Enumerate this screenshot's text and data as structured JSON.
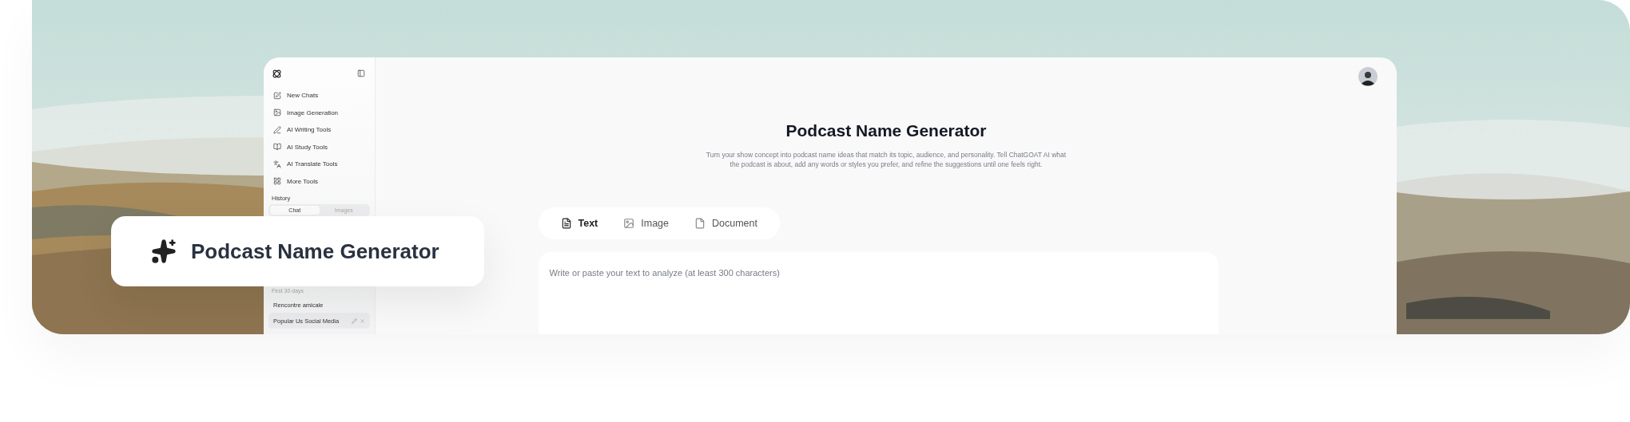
{
  "sidebar": {
    "items": [
      {
        "label": "New Chats"
      },
      {
        "label": "Image Generation"
      },
      {
        "label": "AI Writing Tools"
      },
      {
        "label": "AI Study Tools"
      },
      {
        "label": "AI Translate Tools"
      },
      {
        "label": "More Tools"
      }
    ],
    "history": {
      "title": "History",
      "tabs": [
        {
          "label": "Chat",
          "selected": true
        },
        {
          "label": "Images",
          "selected": false
        }
      ],
      "section": "First 30 days",
      "entries": [
        {
          "label": "Rencontre amicale",
          "selected": false
        },
        {
          "label": "Popular Us Social Media",
          "selected": true
        }
      ]
    }
  },
  "main": {
    "title": "Podcast Name Generator",
    "description": "Turn your show concept into podcast name ideas that match its topic, audience, and personality. Tell ChatGOAT AI what the podcast is about, add any words or styles you prefer, and refine the suggestions until one feels right.",
    "tabs": [
      {
        "label": "Text",
        "selected": true
      },
      {
        "label": "Image",
        "selected": false
      },
      {
        "label": "Document",
        "selected": false
      }
    ],
    "input": {
      "placeholder": "Write or paste your text to analyze (at least 300 characters)"
    }
  },
  "feature_card": {
    "title": "Podcast Name Generator"
  }
}
